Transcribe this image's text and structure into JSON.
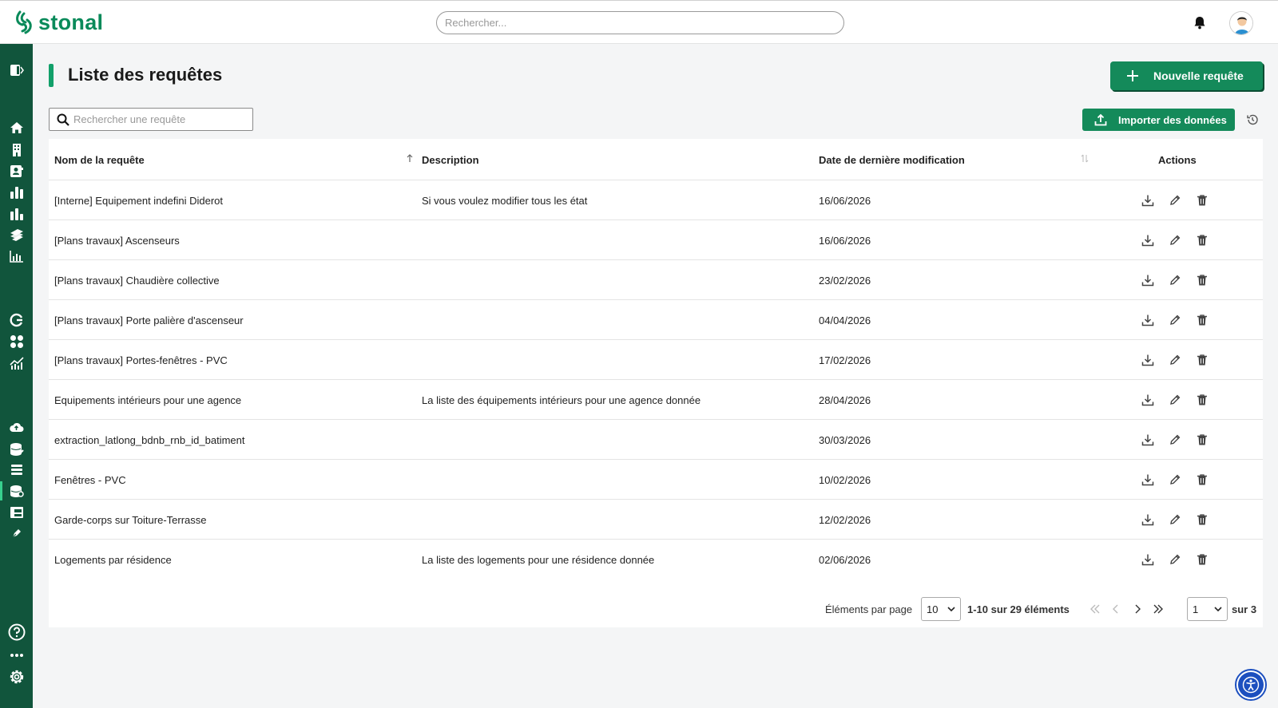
{
  "app": {
    "logo_text": "stonal",
    "brand_color": "#0a8a5a",
    "sidebar_color": "#11553c"
  },
  "header": {
    "search_placeholder": "Rechercher...",
    "notifications_icon": "bell-icon",
    "avatar_icon": "user-avatar"
  },
  "page": {
    "title": "Liste des requêtes",
    "new_button_label": "Nouvelle requête",
    "import_button_label": "Importer des données",
    "search_placeholder": "Rechercher une requête"
  },
  "table": {
    "columns": {
      "name": "Nom de la requête",
      "description": "Description",
      "date": "Date de dernière modification",
      "actions": "Actions"
    },
    "rows": [
      {
        "name": "[Interne] Equipement indefini Diderot",
        "description": "Si vous voulez modifier tous les état",
        "date": "16/06/2026"
      },
      {
        "name": "[Plans travaux] Ascenseurs",
        "description": "",
        "date": "16/06/2026"
      },
      {
        "name": "[Plans travaux] Chaudière collective",
        "description": "",
        "date": "23/02/2026"
      },
      {
        "name": "[Plans travaux] Porte palière d'ascenseur",
        "description": "",
        "date": "04/04/2026"
      },
      {
        "name": "[Plans travaux] Portes-fenêtres - PVC",
        "description": "",
        "date": "17/02/2026"
      },
      {
        "name": "Equipements intérieurs pour une agence",
        "description": "La liste des équipements intérieurs pour une agence donnée",
        "date": "28/04/2026"
      },
      {
        "name": "extraction_latlong_bdnb_rnb_id_batiment",
        "description": "",
        "date": "30/03/2026"
      },
      {
        "name": "Fenêtres - PVC",
        "description": "",
        "date": "10/02/2026"
      },
      {
        "name": "Garde-corps sur Toiture-Terrasse",
        "description": "",
        "date": "12/02/2026"
      },
      {
        "name": "Logements par résidence",
        "description": "La liste des logements pour une résidence donnée",
        "date": "02/06/2026"
      }
    ]
  },
  "pagination": {
    "per_page_label": "Éléments par page",
    "per_page_value": "10",
    "range_label": "1-10 sur 29 éléments",
    "page_value": "1",
    "total_label": "sur 3"
  }
}
